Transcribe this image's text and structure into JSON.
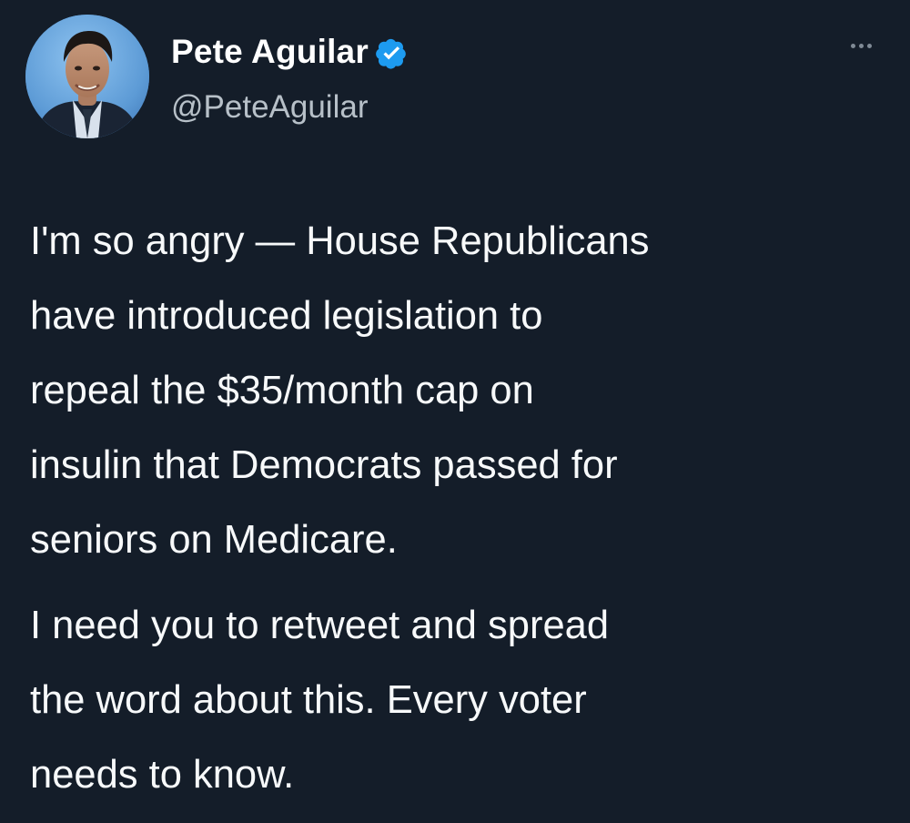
{
  "author": {
    "display_name": "Pete Aguilar",
    "handle": "@PeteAguilar"
  },
  "tweet": {
    "paragraphs": [
      "I'm so angry — House Republicans\nhave introduced legislation to\nrepeal the $35/month cap on\ninsulin that Democrats passed for\nseniors on Medicare.",
      "I need you to retweet and spread\nthe word about this. Every voter\nneeds to know."
    ]
  },
  "icons": {
    "verified": "verified-badge-icon",
    "more": "more-options-icon"
  },
  "colors": {
    "background": "#141d29",
    "text": "#f7f9fa",
    "muted": "#b7c0c8",
    "verified": "#1d9bf0"
  }
}
